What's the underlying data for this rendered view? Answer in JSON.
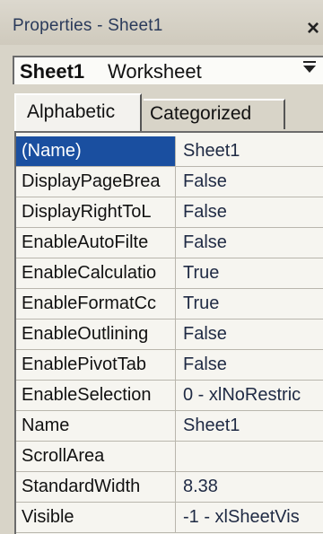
{
  "window": {
    "title": "Properties - Sheet1",
    "close_label": "×"
  },
  "object_selector": {
    "name": "Sheet1",
    "type": "Worksheet"
  },
  "tabs": [
    {
      "label": "Alphabetic",
      "active": true
    },
    {
      "label": "Categorized",
      "active": false
    }
  ],
  "properties": [
    {
      "name": "(Name)",
      "value": "Sheet1",
      "selected": true
    },
    {
      "name": "DisplayPageBrea",
      "value": "False"
    },
    {
      "name": "DisplayRightToL",
      "value": "False"
    },
    {
      "name": "EnableAutoFilte",
      "value": "False"
    },
    {
      "name": "EnableCalculatio",
      "value": "True"
    },
    {
      "name": "EnableFormatCc",
      "value": "True"
    },
    {
      "name": "EnableOutlining",
      "value": "False"
    },
    {
      "name": "EnablePivotTab",
      "value": "False"
    },
    {
      "name": "EnableSelection",
      "value": "0 - xlNoRestric"
    },
    {
      "name": "Name",
      "value": "Sheet1"
    },
    {
      "name": "ScrollArea",
      "value": ""
    },
    {
      "name": "StandardWidth",
      "value": "8.38"
    },
    {
      "name": "Visible",
      "value": "-1 - xlSheetVis"
    }
  ],
  "colors": {
    "selection": "#1a4fa0",
    "window_bg": "#d8d4c8",
    "grid_bg": "#f6f5f0"
  }
}
